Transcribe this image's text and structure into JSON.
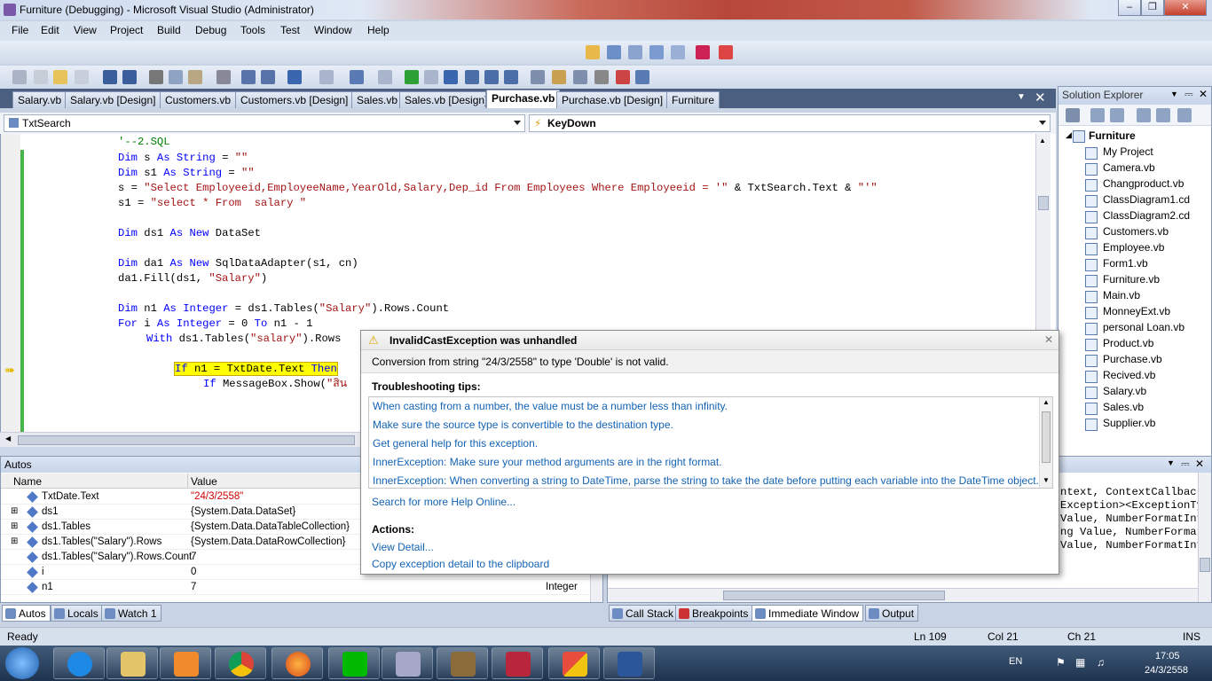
{
  "window": {
    "title": "Furniture (Debugging) - Microsoft Visual Studio (Administrator)"
  },
  "menu": [
    "File",
    "Edit",
    "View",
    "Project",
    "Build",
    "Debug",
    "Tools",
    "Test",
    "Window",
    "Help"
  ],
  "tabs": [
    {
      "label": "Salary.vb"
    },
    {
      "label": "Salary.vb [Design]"
    },
    {
      "label": "Customers.vb"
    },
    {
      "label": "Customers.vb [Design]"
    },
    {
      "label": "Sales.vb"
    },
    {
      "label": "Sales.vb [Design]"
    },
    {
      "label": "Purchase.vb",
      "active": true
    },
    {
      "label": "Purchase.vb [Design]"
    },
    {
      "label": "Furniture"
    }
  ],
  "nav": {
    "object": "TxtSearch",
    "event": "KeyDown"
  },
  "code": {
    "l1": "'--2.SQL",
    "l2": "Dim s As String = \"\"",
    "l3": "Dim s1 As String = \"\"",
    "l4": "s = \"Select Employeeid,EmployeeName,YearOld,Salary,Dep_id From Employees Where Employeeid = '\" & TxtSearch.Text & \"'\"",
    "l5": "s1 = \"select * From  salary \"",
    "l6": "Dim ds1 As New DataSet",
    "l7": "Dim da1 As New SqlDataAdapter(s1, cn)",
    "l8": "da1.Fill(ds1, \"Salary\")",
    "l9": "Dim n1 As Integer = ds1.Tables(\"Salary\").Rows.Count",
    "l10": "For i As Integer = 0 To n1 - 1",
    "l11": "With ds1.Tables(\"salary\").Rows",
    "l12": "If n1 = TxtDate.Text Then",
    "l13": "If MessageBox.Show(\"สิน"
  },
  "solution_explorer": {
    "title": "Solution Explorer",
    "root": "Furniture",
    "items": [
      "My Project",
      "Camera.vb",
      "Changproduct.vb",
      "ClassDiagram1.cd",
      "ClassDiagram2.cd",
      "Customers.vb",
      "Employee.vb",
      "Form1.vb",
      "Furniture.vb",
      "Main.vb",
      "MonneyExt.vb",
      "personal Loan.vb",
      "Product.vb",
      "Purchase.vb",
      "Recived.vb",
      "Salary.vb",
      "Sales.vb",
      "Supplier.vb"
    ]
  },
  "autos": {
    "title": "Autos",
    "col_name": "Name",
    "col_value": "Value",
    "rows": [
      {
        "name": "TxtDate.Text",
        "value": "\"24/3/2558\"",
        "type": ""
      },
      {
        "name": "ds1",
        "value": "{System.Data.DataSet}",
        "type": ""
      },
      {
        "name": "ds1.Tables",
        "value": "{System.Data.DataTableCollection}",
        "type": ""
      },
      {
        "name": "ds1.Tables(\"Salary\").Rows",
        "value": "{System.Data.DataRowCollection}",
        "type": ""
      },
      {
        "name": "ds1.Tables(\"Salary\").Rows.Count",
        "value": "7",
        "type": ""
      },
      {
        "name": "i",
        "value": "0",
        "type": ""
      },
      {
        "name": "n1",
        "value": "7",
        "type": "Integer"
      }
    ]
  },
  "bottom_tabs_left": [
    "Autos",
    "Locals",
    "Watch 1"
  ],
  "bottom_tabs_right": [
    "Call Stack",
    "Breakpoints",
    "Immediate Window",
    "Output"
  ],
  "immediate_lines": [
    "ntext, ContextCallback",
    "Exception><ExceptionTy",
    "Value, NumberFormatInf",
    "ng Value, NumberFormatI",
    "Value, NumberFormatInf"
  ],
  "dialog": {
    "title": "InvalidCastException was unhandled",
    "message": "Conversion from string \"24/3/2558\" to type 'Double' is not valid.",
    "tips_header": "Troubleshooting tips:",
    "tips": [
      "When casting from a number, the value must be a number less than infinity.",
      "Make sure the source type is convertible to the destination type.",
      "Get general help for this exception.",
      "InnerException: Make sure your method arguments are in the right format.",
      "InnerException: When converting a string to DateTime, parse the string to take the date before putting each variable into the DateTime object."
    ],
    "search_link": "Search for more Help Online...",
    "actions_header": "Actions:",
    "actions": [
      "View Detail...",
      "Copy exception detail to the clipboard"
    ]
  },
  "status": {
    "text": "Ready",
    "ln": "Ln 109",
    "col": "Col 21",
    "ch": "Ch 21",
    "mode": "INS"
  },
  "taskbar": {
    "lang": "EN",
    "time": "17:05",
    "date": "24/3/2558"
  }
}
